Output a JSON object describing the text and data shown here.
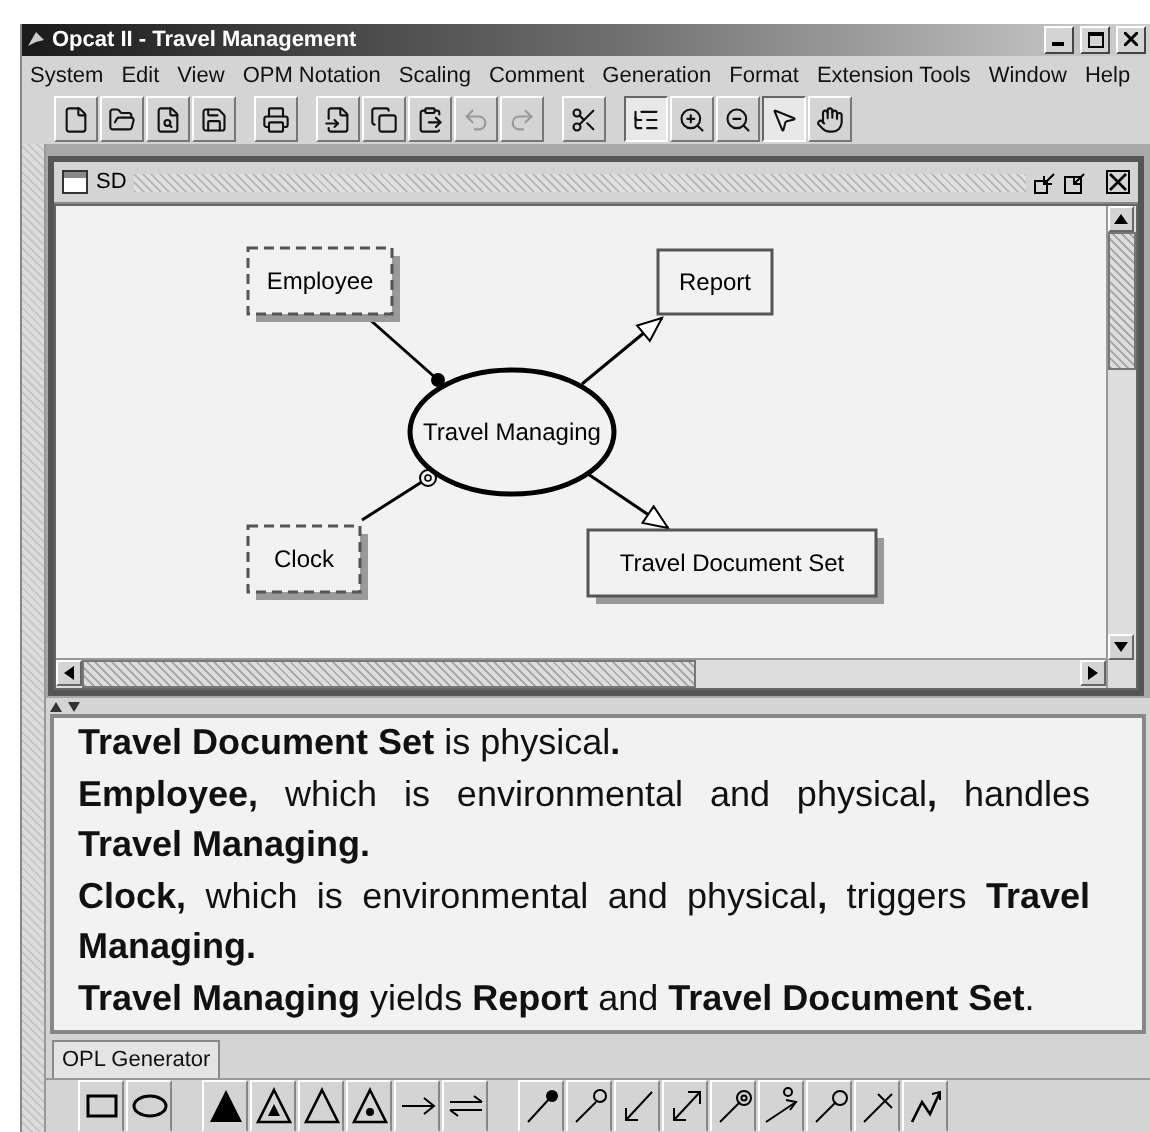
{
  "window": {
    "title": "Opcat II - Travel Management"
  },
  "menu": [
    "System",
    "Edit",
    "View",
    "OPM Notation",
    "Scaling",
    "Comment",
    "Generation",
    "Format",
    "Extension Tools",
    "Window",
    "Help"
  ],
  "toolbar": [
    {
      "selected": false,
      "disabled": false
    },
    {
      "selected": false,
      "disabled": false
    },
    {
      "selected": false,
      "disabled": false
    },
    {
      "selected": false,
      "disabled": false
    },
    {
      "selected": false,
      "disabled": false
    },
    {
      "selected": false,
      "disabled": false
    },
    {
      "selected": false,
      "disabled": false
    },
    {
      "selected": false,
      "disabled": false
    },
    {
      "selected": false,
      "disabled": true
    },
    {
      "selected": false,
      "disabled": true
    },
    {
      "selected": false,
      "disabled": false
    },
    {
      "selected": true,
      "disabled": false
    },
    {
      "selected": false,
      "disabled": false
    },
    {
      "selected": false,
      "disabled": false
    },
    {
      "selected": true,
      "disabled": false
    },
    {
      "selected": false,
      "disabled": false
    }
  ],
  "diagram": {
    "title": "SD",
    "things": [
      {
        "label": "Employee",
        "kind": "object",
        "environmental": true,
        "physical": true
      },
      {
        "label": "Report",
        "kind": "object",
        "environmental": false,
        "physical": false
      },
      {
        "label": "Travel Managing",
        "kind": "process",
        "environmental": false,
        "physical": false
      },
      {
        "label": "Clock",
        "kind": "object",
        "environmental": true,
        "physical": true
      },
      {
        "label": "Travel Document Set",
        "kind": "object",
        "environmental": false,
        "physical": true
      }
    ],
    "links": [
      {
        "kind": "agent"
      },
      {
        "kind": "result"
      },
      {
        "kind": "result"
      },
      {
        "kind": "event"
      }
    ]
  },
  "opl": [
    "**Travel Document Set** is physical**.**",
    "**Employee,** which is environmental and physical**,** handles **Travel Managing.**",
    "**Clock,** which is environmental and physical**,** triggers **Travel Managing.**",
    "**Travel Managing** yields **Report** and **Travel Document Set**."
  ],
  "tabs": [
    {
      "label": "OPL Generator",
      "selected": true
    }
  ]
}
